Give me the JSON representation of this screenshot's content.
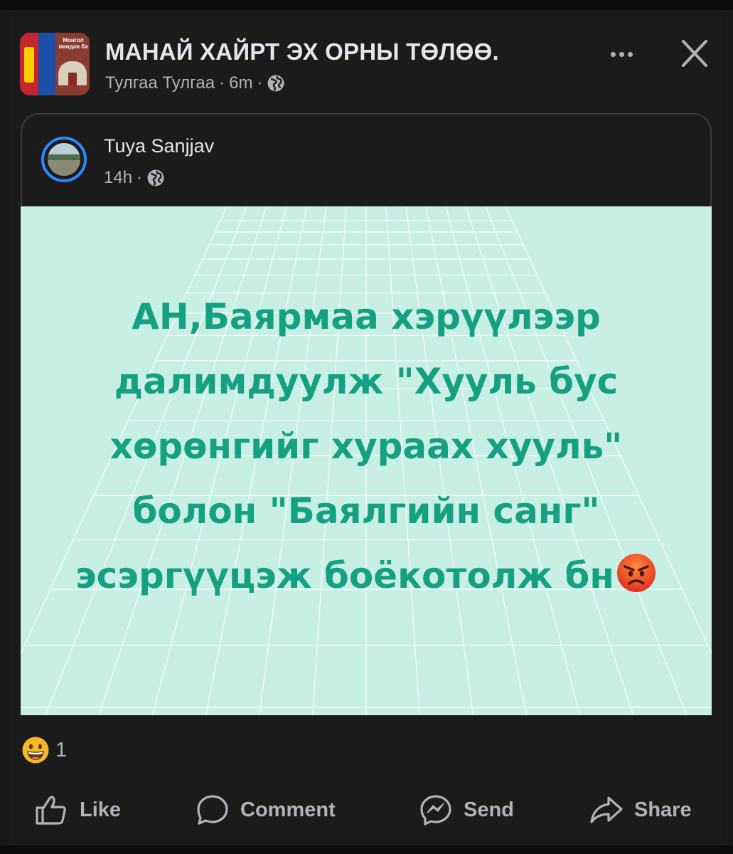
{
  "group": {
    "title": "МАНАЙ ХАЙРТ ЭХ ОРНЫ ТӨЛӨӨ.",
    "author": "Тулгаа Тулгаа",
    "time": "6m",
    "separator": "·",
    "avatar_text": "Монгол мандан ба",
    "privacy_icon": "globe-icon"
  },
  "shared_post": {
    "author": "Tuya Sanjjav",
    "time": "14h",
    "separator": "·",
    "privacy_icon": "globe-icon",
    "text": "АН,Баярмаа хэрүүлээр далимдуулж \"Хууль бус хөрөнгийг хураах хууль\" болон \"Баялгийн санг\" эсэргүүцэж боёкотолж бн",
    "emoji": "angry-face",
    "background_color": "#c8efe4",
    "text_color": "#16a083"
  },
  "reactions": {
    "emoji": "grinning-face",
    "count": "1"
  },
  "actions": {
    "like": "Like",
    "comment": "Comment",
    "send": "Send",
    "share": "Share"
  },
  "colors": {
    "background": "#18191a",
    "primary_text": "#e4e6eb",
    "secondary_text": "#b0b3b8",
    "accent": "#2d88ff"
  }
}
